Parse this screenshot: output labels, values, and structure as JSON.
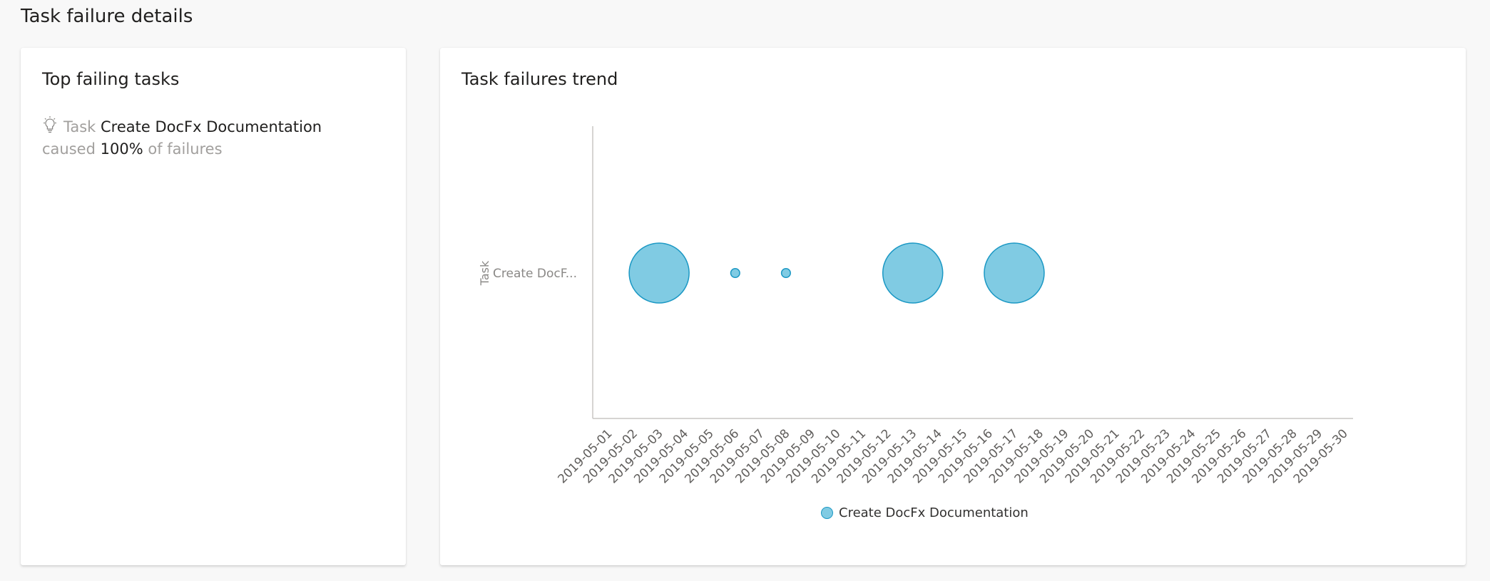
{
  "page": {
    "title": "Task failure details"
  },
  "top_failing": {
    "title": "Top failing tasks",
    "icon": "lightbulb-icon",
    "prefix": "Task",
    "task_name": "Create DocFx Documentation",
    "caused": "caused",
    "percent": "100%",
    "suffix": "of failures"
  },
  "trend": {
    "title": "Task failures trend",
    "y_axis_title": "Task",
    "category_label": "Create DocF...",
    "legend_label": "Create DocFx Documentation"
  },
  "chart_data": {
    "type": "scatter",
    "title": "Task failures trend",
    "ylabel": "Task",
    "categories": [
      "Create DocFx Documentation"
    ],
    "x": [
      "2019-05-01",
      "2019-05-02",
      "2019-05-03",
      "2019-05-04",
      "2019-05-05",
      "2019-05-06",
      "2019-05-07",
      "2019-05-08",
      "2019-05-09",
      "2019-05-10",
      "2019-05-11",
      "2019-05-12",
      "2019-05-13",
      "2019-05-14",
      "2019-05-15",
      "2019-05-16",
      "2019-05-17",
      "2019-05-18",
      "2019-05-19",
      "2019-05-20",
      "2019-05-21",
      "2019-05-22",
      "2019-05-23",
      "2019-05-24",
      "2019-05-25",
      "2019-05-26",
      "2019-05-27",
      "2019-05-28",
      "2019-05-29",
      "2019-05-30"
    ],
    "series": [
      {
        "name": "Create DocFx Documentation",
        "color": "#80cbe3",
        "stroke": "#1b98c4",
        "points": [
          {
            "x": "2019-05-03",
            "y": "Create DocFx Documentation",
            "size": 1.0
          },
          {
            "x": "2019-05-06",
            "y": "Create DocFx Documentation",
            "size": 0.15
          },
          {
            "x": "2019-05-08",
            "y": "Create DocFx Documentation",
            "size": 0.15
          },
          {
            "x": "2019-05-13",
            "y": "Create DocFx Documentation",
            "size": 1.0
          },
          {
            "x": "2019-05-17",
            "y": "Create DocFx Documentation",
            "size": 1.0
          }
        ]
      }
    ],
    "legend": "bottom-center",
    "grid": false
  }
}
